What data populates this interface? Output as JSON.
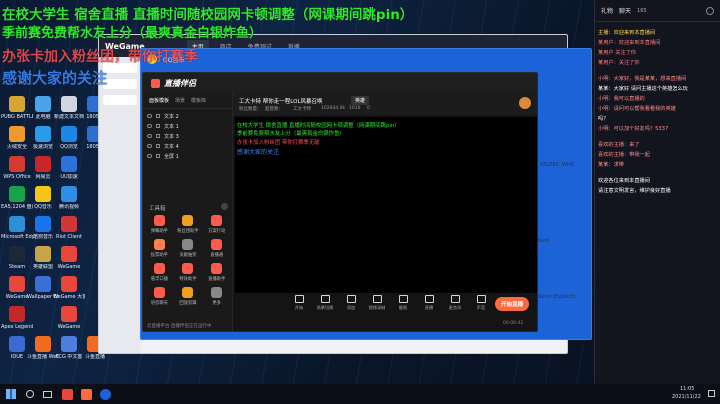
{
  "overlay": {
    "line1": "在校大学生 宿舍直播  直播时间随校园网卡顿调整（网课期间跳pin）",
    "line2": "季前赛免费帮水友上分（最爽真金白银炸鱼）",
    "line3": "办张卡加入粉丝团，带你打赛季",
    "line4": "感谢大家的关注"
  },
  "desktop_icons": [
    {
      "label": "",
      "color": "#2f8de4"
    },
    {
      "label": "",
      "color": "#1fb15a"
    },
    {
      "label": "",
      "color": "#e84a3c"
    },
    {
      "label": "",
      "color": "#3d6ed8"
    },
    {
      "label": "PUBG BATTLEGR",
      "color": "#d9a531"
    },
    {
      "label": "此电脑",
      "color": "#4aa3e8"
    },
    {
      "label": "新建文本文档",
      "color": "#d0d6e2"
    },
    {
      "label": "1805...",
      "color": "#2b6fd1"
    },
    {
      "label": "火绒安全",
      "color": "#f09a2b"
    },
    {
      "label": "极速浏览",
      "color": "#2a9be6"
    },
    {
      "label": "QQ浏览",
      "color": "#1d87e5"
    },
    {
      "label": "1805...",
      "color": "#2b6fd1"
    },
    {
      "label": "WPS Office",
      "color": "#d63a2e"
    },
    {
      "label": "网易云",
      "color": "#c8272a"
    },
    {
      "label": "UU加速",
      "color": "#2c72d8"
    },
    {
      "label": "EA5,1204 盘片大百",
      "color": "#16a34a"
    },
    {
      "label": "QQ音乐",
      "color": "#f5c518"
    },
    {
      "label": "腾讯视频",
      "color": "#2f8de4"
    },
    {
      "label": "Microsoft Edge",
      "color": "#2c8fd7"
    },
    {
      "label": "酷狗音乐",
      "color": "#1a73e8"
    },
    {
      "label": "Riot Client",
      "color": "#d13639"
    },
    {
      "label": "Steam",
      "color": "#1b2838"
    },
    {
      "label": "英雄联盟",
      "color": "#c8a548"
    },
    {
      "label": "WeGame",
      "color": "#e8483c"
    },
    {
      "label": "WeGame",
      "color": "#e8483c"
    },
    {
      "label": "Wallpaper Engine",
      "color": "#3b6fd4"
    },
    {
      "label": "WeGame 大客",
      "color": "#e8483c"
    },
    {
      "label": "Apex Legends",
      "color": "#c62828"
    },
    {
      "label": "WeGame",
      "color": "#e8483c"
    },
    {
      "label": "IDUE",
      "color": "#3a6ad2"
    },
    {
      "label": "斗鱼直播 WeGame版",
      "color": "#f06a1f"
    },
    {
      "label": "FCG 中文客",
      "color": "#4c7ee0"
    },
    {
      "label": "斗鱼直播",
      "color": "#f06a1f"
    }
  ],
  "wegame": {
    "logo": "WeGame",
    "tabs": [
      "主页",
      "商店",
      "免费测试",
      "直播"
    ],
    "active_tab": "主页"
  },
  "qq": {
    "title": "QQ音乐"
  },
  "companion": {
    "brand": "直播伴侣",
    "tabs": [
      "面板模板",
      "场景",
      "模板库"
    ],
    "sources": [
      "文本 2",
      "文本 1",
      "文本 3",
      "文本 4",
      "全屏 1"
    ],
    "tools_title": "工具箱",
    "tools": [
      {
        "label": "弹幕助手",
        "color": "#ff5a4d"
      },
      {
        "label": "粉丝团助手",
        "color": "#f0a020"
      },
      {
        "label": "方案行动",
        "color": "#ff5a4d"
      },
      {
        "label": "投票助手",
        "color": "#ff7f50"
      },
      {
        "label": "贡献抽奖",
        "color": "#888"
      },
      {
        "label": "直播通",
        "color": "#ff5a4d"
      },
      {
        "label": "悬浮口播",
        "color": "#ff5a4d"
      },
      {
        "label": "特效助手",
        "color": "#ff5a4d"
      },
      {
        "label": "直播助手",
        "color": "#ff5a4d"
      },
      {
        "label": "语音聊天",
        "color": "#ff5a4d"
      },
      {
        "label": "回放剪辑",
        "color": "#f0a020"
      },
      {
        "label": "更多",
        "color": "#888"
      }
    ],
    "room_title": "工大卡特 帮你走一程LOL风暴召唤",
    "room_tag": "英雄",
    "room_meta": [
      "粉丝数量：",
      "超管数：",
      "工大卡特",
      "102644.0k",
      "1010",
      "0"
    ],
    "preview_text": {
      "l1": "在校大学生 宿舍直播  直播时间随校园网卡顿调整（网课期间跳pin）",
      "l2": "季前赛免费帮水友上分（最爽真金白银炸鱼）",
      "l3": "办张卡加入粉丝团 带你打赛季无敌",
      "l4": "感谢大家的关注"
    },
    "bottom_tools": [
      "开始",
      "场景切换",
      "添加",
      "视频录制",
      "截图",
      "直播",
      "麦克风",
      "声音"
    ],
    "start_button": "开始直播",
    "footer_left": "云直播平台 直播伴侣正在运行中",
    "footer_right": "00:00:42"
  },
  "chat": {
    "tabs": [
      "礼物",
      "聊天"
    ],
    "count": "165",
    "lines": [
      {
        "text": "主播：欢迎来到本直播间",
        "color": "#ffd84d"
      },
      {
        "text": "某用户：欢迎来到本直播间",
        "color": "#ff7b7b"
      },
      {
        "text": "某用户 关注了你",
        "color": "#ff7b7b"
      },
      {
        "text": "某用户：关注了你",
        "color": "#ff7b7b"
      },
      {
        "text": "小明：大家好，我是某某，想来直播间",
        "color": "#ff8a8a"
      },
      {
        "text": "某某：大家好 请问主播这个英雄怎么玩",
        "color": "#ffffff"
      },
      {
        "text": "小明：我可以直播的",
        "color": "#ff8a8a"
      },
      {
        "text": "小明：请问可以帮我看看我的英雄",
        "color": "#ff8a8a"
      },
      {
        "text": "吗？",
        "color": "#ffffff"
      },
      {
        "text": "小明：可以加个好友吗？5337",
        "color": "#ff8a8a"
      },
      {
        "text": "喜欢的主播：来了",
        "color": "#ff8a8a"
      },
      {
        "text": "喜欢的主播：带我一起",
        "color": "#ff8a8a"
      },
      {
        "text": "某某：求带",
        "color": "#ff8a8a"
      },
      {
        "text": "欢迎各位来到本直播间",
        "color": "#ffffff"
      },
      {
        "text": "请注意文明发言，维护良好直播",
        "color": "#ffffff"
      }
    ]
  },
  "right_partial": {
    "text1": "ASLEEP, WHE...",
    "text2": "Sonic (Explicit)",
    "text3": "bum"
  },
  "taskbar": {
    "time": "11:05",
    "date": "2021/11/22"
  },
  "colors": {
    "accent": "#ff6a3d",
    "wegame_red": "#e8483c",
    "qq_blue": "#1c63d8",
    "overlay_green": "#2eea2e",
    "overlay_yellow": "#f0e040"
  }
}
